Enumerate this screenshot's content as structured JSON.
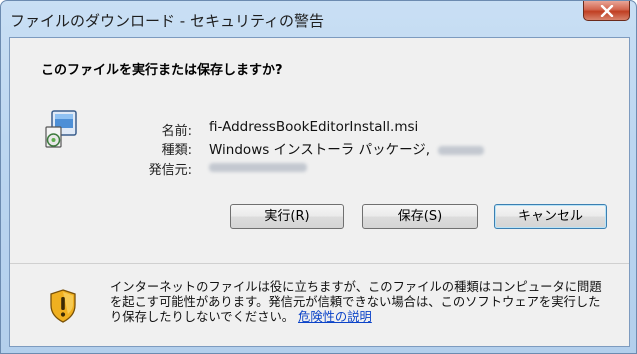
{
  "window": {
    "title": "ファイルのダウンロード - セキュリティの警告",
    "close_label": "X"
  },
  "dialog": {
    "question": "このファイルを実行または保存しますか?",
    "fields": {
      "name_label": "名前:",
      "name_value": "fi-AddressBookEditorInstall.msi",
      "type_label": "種類:",
      "type_value": "Windows インストーラ パッケージ,",
      "from_label": "発信元:"
    },
    "buttons": {
      "run": "実行(R)",
      "save": "保存(S)",
      "cancel": "キャンセル"
    },
    "warning": {
      "text": "インターネットのファイルは役に立ちますが、このファイルの種類はコンピュータに問題を起こす可能性があります。発信元が信頼できない場合は、このソフトウェアを実行したり保存したりしないでください。",
      "link": "危険性の説明"
    }
  },
  "icons": {
    "file": "msi-installer-icon",
    "warning": "shield-warning-icon",
    "close": "close-icon"
  },
  "colors": {
    "title_bar": "#bcd6f0",
    "close_button": "#c03f22",
    "link": "#0b43c8",
    "shield": "#f0b020"
  }
}
